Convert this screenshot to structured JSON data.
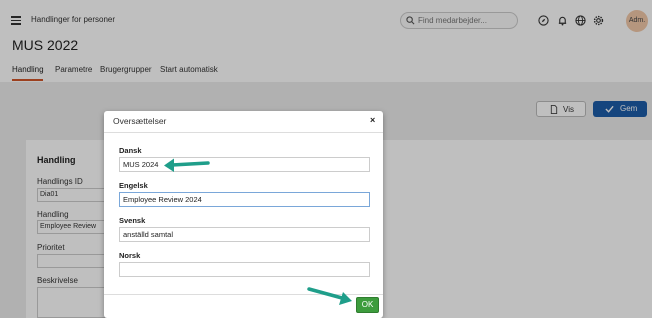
{
  "header": {
    "app_title": "Handlinger for personer",
    "search_placeholder": "Find medarbejder...",
    "avatar_label": "Adm."
  },
  "page": {
    "title": "MUS 2022",
    "tabs": [
      {
        "label": "Handling",
        "active": true
      },
      {
        "label": "Parametre",
        "active": false
      },
      {
        "label": "Brugergrupper",
        "active": false
      },
      {
        "label": "Start automatisk",
        "active": false
      }
    ],
    "buttons": {
      "vis": "Vis",
      "gem": "Gem"
    }
  },
  "form": {
    "section_title": "Handling",
    "fields": [
      {
        "label": "Handlings ID",
        "value": "Dia01"
      },
      {
        "label": "Handling",
        "value": "Employee Review"
      },
      {
        "label": "Prioritet",
        "value": ""
      },
      {
        "label": "Beskrivelse",
        "value": ""
      }
    ]
  },
  "modal": {
    "title": "Oversættelser",
    "close": "×",
    "fields": [
      {
        "label": "Dansk",
        "value": "MUS 2024"
      },
      {
        "label": "Engelsk",
        "value": "Employee Review 2024"
      },
      {
        "label": "Svensk",
        "value": "anställd samtal"
      },
      {
        "label": "Norsk",
        "value": ""
      }
    ],
    "ok_label": "OK"
  },
  "colors": {
    "accent": "#d0562a",
    "primary_button": "#1d5ca8",
    "ok_button": "#3d9c3d",
    "annotation_arrow": "#1f9e8a"
  }
}
